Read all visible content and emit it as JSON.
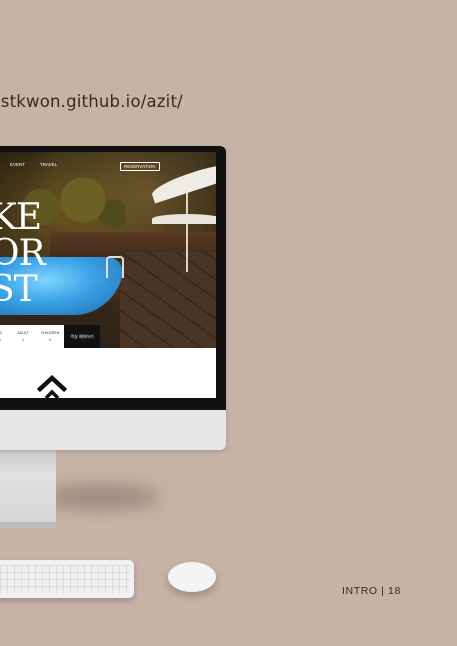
{
  "page": {
    "url_text": "istkwon.github.io/azit/",
    "section_label": "INTRO | 18"
  },
  "site": {
    "nav": [
      "EVENT",
      "TRAVEL"
    ],
    "reservation_label": "RESERVATION",
    "hero_lines": [
      "KE",
      "OR",
      "ST"
    ],
    "booking_fields": [
      {
        "label": "M",
        "value": "1"
      },
      {
        "label": "ADULT",
        "value": "1"
      },
      {
        "label": "CHILDREN",
        "value": "0"
      }
    ],
    "book_button_label": "객실 예약하기"
  },
  "colors": {
    "background": "#c6b3a6",
    "text": "#3a2a1e",
    "pool": "#3aa2e6"
  }
}
